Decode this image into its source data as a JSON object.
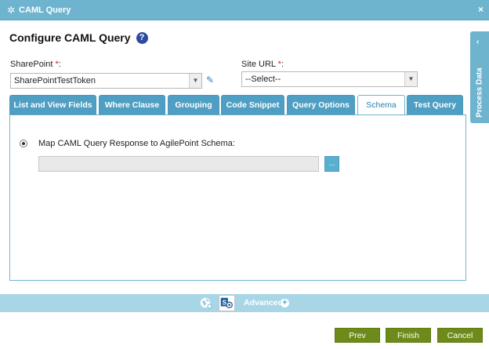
{
  "window": {
    "title": "CAML Query",
    "close_label": "×"
  },
  "heading": "Configure CAML Query",
  "help_label": "?",
  "sharepoint": {
    "label": "SharePoint",
    "required_mark": "*",
    "colon": ":",
    "value": "SharePointTestToken"
  },
  "site_url": {
    "label": "Site URL",
    "required_mark": "*",
    "colon": ":",
    "value": "--Select--"
  },
  "tabs": [
    {
      "label": "List and View Fields"
    },
    {
      "label": "Where Clause"
    },
    {
      "label": "Grouping"
    },
    {
      "label": "Code Snippet"
    },
    {
      "label": "Query Options"
    },
    {
      "label": "Schema"
    },
    {
      "label": "Test Query"
    }
  ],
  "active_tab": "Schema",
  "schema": {
    "radio_label": "Map CAML Query Response to AgilePoint Schema:",
    "input_value": "",
    "browse_label": "..."
  },
  "side_panel": {
    "label": "Process Data",
    "chevron": "‹"
  },
  "advanced": {
    "label": "Advanced",
    "plus": "+"
  },
  "buttons": {
    "prev": "Prev",
    "finish": "Finish",
    "cancel": "Cancel"
  },
  "colors": {
    "accent": "#6fb4cf",
    "tab": "#4e9fc3",
    "button": "#6e8a1a",
    "required": "#d62020"
  }
}
